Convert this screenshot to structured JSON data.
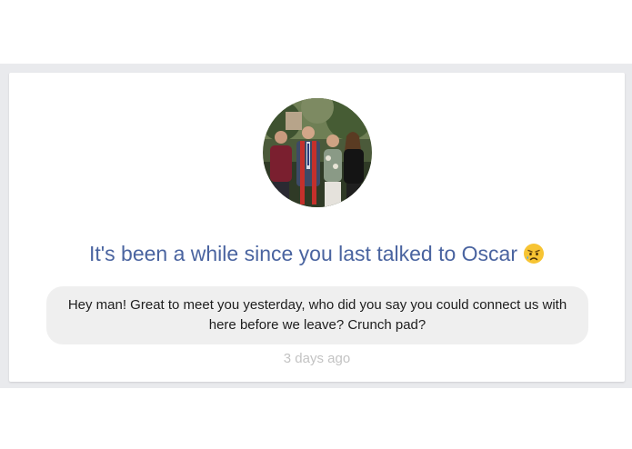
{
  "card": {
    "headline": "It's been a while since you last talked to Oscar",
    "headline_emoji": "disappointed-face-emoji",
    "message": "Hey man! Great to meet you yesterday, who did you say you could connect us with here before we leave? Crunch pad?",
    "timestamp": "3 days ago"
  },
  "colors": {
    "headline": "#4a64a0",
    "bubble_bg": "#efefef",
    "timestamp": "#c3c3c3",
    "page_band": "#e9eaed"
  }
}
